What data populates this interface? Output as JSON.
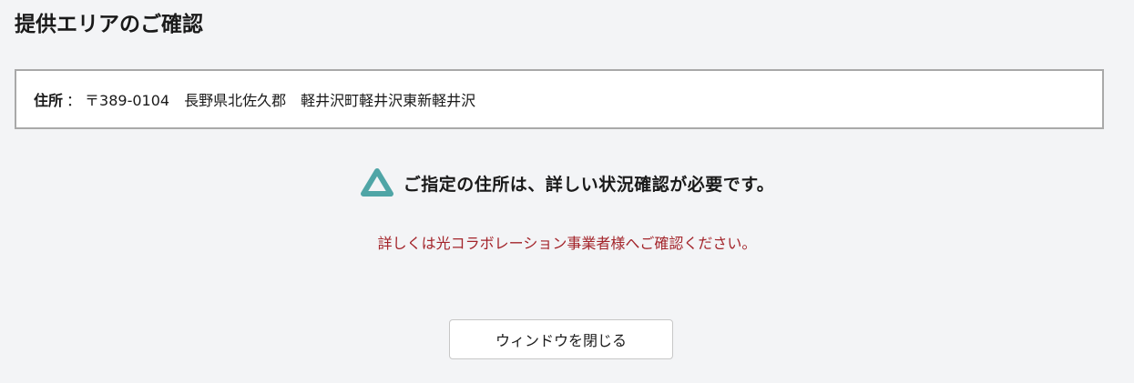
{
  "page": {
    "title": "提供エリアのご確認"
  },
  "address": {
    "label": "住所",
    "separator": "：",
    "value": "〒389-0104　長野県北佐久郡　軽井沢町軽井沢東新軽井沢"
  },
  "status": {
    "icon": "warning-triangle-icon",
    "icon_color": "#4fa5a6",
    "message": "ご指定の住所は、詳しい状況確認が必要です。"
  },
  "notice": {
    "text": "詳しくは光コラボレーション事業者様へご確認ください。",
    "color": "#a3242a"
  },
  "actions": {
    "close_label": "ウィンドウを閉じる"
  }
}
